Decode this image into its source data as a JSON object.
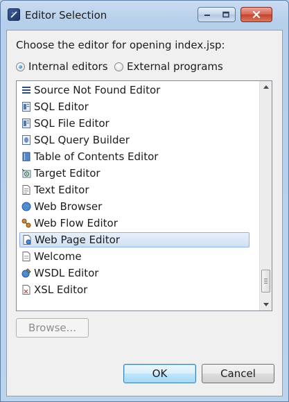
{
  "window": {
    "title": "Editor Selection"
  },
  "prompt": "Choose the editor for opening index.jsp:",
  "radios": [
    {
      "label": "Internal editors",
      "checked": true
    },
    {
      "label": "External programs",
      "checked": false
    }
  ],
  "editors": [
    {
      "label": "Source Not Found Editor",
      "icon": "lines-icon"
    },
    {
      "label": "SQL Editor",
      "icon": "sql-editor-icon"
    },
    {
      "label": "SQL File Editor",
      "icon": "sql-file-icon"
    },
    {
      "label": "SQL Query Builder",
      "icon": "query-builder-icon"
    },
    {
      "label": "Table of Contents Editor",
      "icon": "book-icon"
    },
    {
      "label": "Target Editor",
      "icon": "target-icon"
    },
    {
      "label": "Text Editor",
      "icon": "text-file-icon"
    },
    {
      "label": "Web Browser",
      "icon": "globe-icon"
    },
    {
      "label": "Web Flow Editor",
      "icon": "flow-icon"
    },
    {
      "label": "Web Page Editor",
      "icon": "web-page-icon",
      "selected": true
    },
    {
      "label": "Welcome",
      "icon": "page-icon"
    },
    {
      "label": "WSDL Editor",
      "icon": "wsdl-icon"
    },
    {
      "label": "XSL Editor",
      "icon": "xsl-icon"
    }
  ],
  "buttons": {
    "browse": "Browse...",
    "ok": "OK",
    "cancel": "Cancel"
  },
  "colors": {
    "selection": "#cfe0f6",
    "selection_border": "#8db2e3",
    "title_bg": "#b9d1ea"
  }
}
